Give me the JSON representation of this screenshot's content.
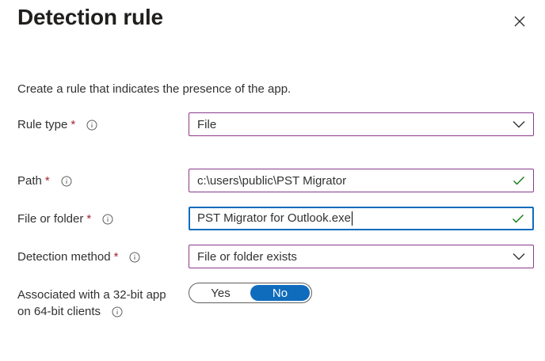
{
  "header": {
    "title": "Detection rule",
    "close_label": "Close"
  },
  "description": "Create a rule that indicates the presence of the app.",
  "form": {
    "rule_type": {
      "label": "Rule type",
      "required_mark": "*",
      "value": "File"
    },
    "path": {
      "label": "Path",
      "required_mark": "*",
      "value": "c:\\users\\public\\PST Migrator"
    },
    "file_or_folder": {
      "label": "File or folder",
      "required_mark": "*",
      "value": "PST Migrator for Outlook.exe"
    },
    "detection_method": {
      "label": "Detection method",
      "required_mark": "*",
      "value": "File or folder exists"
    },
    "associated_32bit": {
      "label_line1": "Associated with a 32-bit app",
      "label_line2": "on 64-bit clients",
      "options": [
        "Yes",
        "No"
      ],
      "selected": "No"
    }
  },
  "colors": {
    "accent": "#0f6cbd",
    "input_border": "#8a3a8c",
    "required": "#a4262c",
    "valid_check": "#107c10"
  }
}
